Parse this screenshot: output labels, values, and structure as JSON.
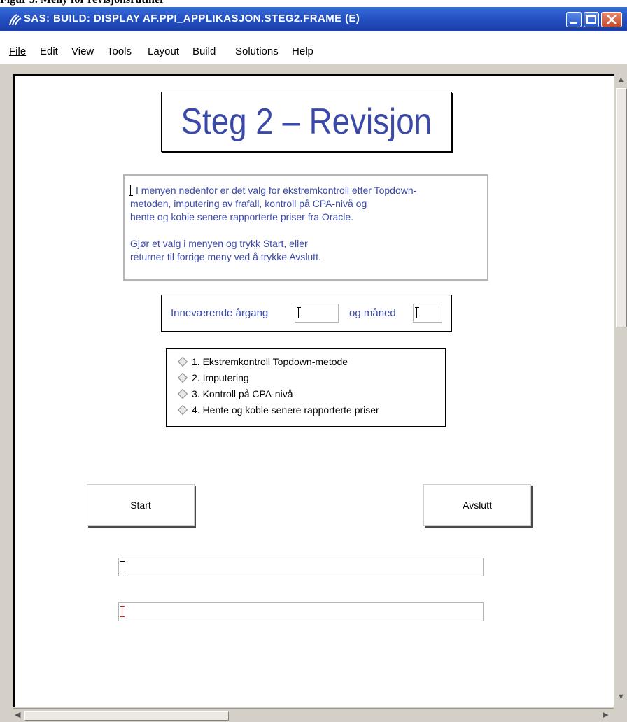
{
  "document": {
    "caption": "Figur 5. Meny for revisjonsrutiner"
  },
  "window": {
    "title": "SAS: BUILD: DISPLAY AF.PPI_APPLIKASJON.STEG2.FRAME (E)"
  },
  "menu": {
    "items": [
      "File",
      "Edit",
      "View",
      "Tools",
      "Layout",
      "Build",
      "Solutions",
      "Help"
    ]
  },
  "frame": {
    "heading": "Steg 2  –  Revisjon",
    "info_lines": [
      "I menyen nedenfor er det valg for ekstremkontroll etter Topdown-",
      "metoden, imputering av frafall, kontroll på CPA-nivå og",
      "hente og koble senere rapporterte priser fra Oracle.",
      "",
      "Gjør et valg i menyen og trykk Start, eller",
      "returner til forrige meny ved å trykke Avslutt."
    ],
    "year_label": "Inneværende årgang",
    "year_value": "",
    "month_label": "og måned",
    "month_value": "",
    "options": [
      "1. Ekstremkontroll Topdown-metode",
      "2. Imputering",
      "3. Kontroll på CPA-nivå",
      "4. Hente og koble senere rapporterte priser"
    ],
    "start_label": "Start",
    "exit_label": "Avslutt",
    "message_field_1": "",
    "message_field_2": ""
  },
  "colors": {
    "accent_text": "#3b4aa8",
    "titlebar": "#2451c4"
  },
  "icons": [
    "sas-logo-icon",
    "minimize-icon",
    "maximize-icon",
    "close-icon",
    "radio-diamond-icon",
    "text-cursor-icon"
  ]
}
